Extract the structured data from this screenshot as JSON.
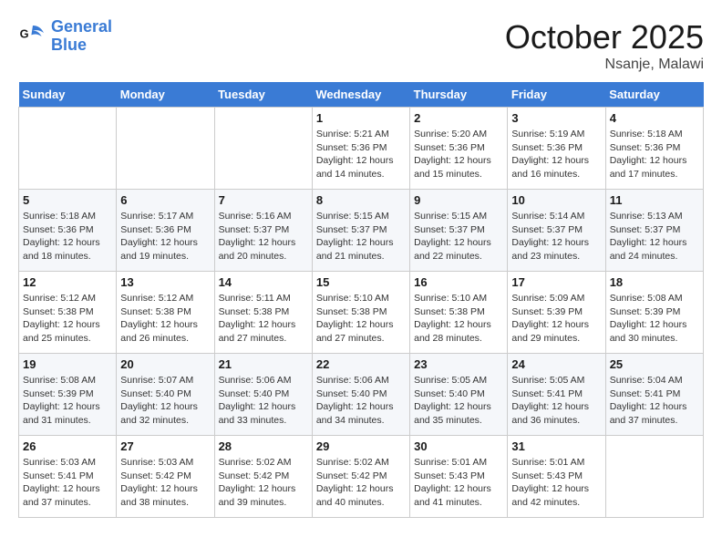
{
  "logo": {
    "line1": "General",
    "line2": "Blue"
  },
  "title": "October 2025",
  "location": "Nsanje, Malawi",
  "days_of_week": [
    "Sunday",
    "Monday",
    "Tuesday",
    "Wednesday",
    "Thursday",
    "Friday",
    "Saturday"
  ],
  "weeks": [
    [
      {
        "day": "",
        "sunrise": "",
        "sunset": "",
        "daylight": ""
      },
      {
        "day": "",
        "sunrise": "",
        "sunset": "",
        "daylight": ""
      },
      {
        "day": "",
        "sunrise": "",
        "sunset": "",
        "daylight": ""
      },
      {
        "day": "1",
        "sunrise": "Sunrise: 5:21 AM",
        "sunset": "Sunset: 5:36 PM",
        "daylight": "Daylight: 12 hours and 14 minutes."
      },
      {
        "day": "2",
        "sunrise": "Sunrise: 5:20 AM",
        "sunset": "Sunset: 5:36 PM",
        "daylight": "Daylight: 12 hours and 15 minutes."
      },
      {
        "day": "3",
        "sunrise": "Sunrise: 5:19 AM",
        "sunset": "Sunset: 5:36 PM",
        "daylight": "Daylight: 12 hours and 16 minutes."
      },
      {
        "day": "4",
        "sunrise": "Sunrise: 5:18 AM",
        "sunset": "Sunset: 5:36 PM",
        "daylight": "Daylight: 12 hours and 17 minutes."
      }
    ],
    [
      {
        "day": "5",
        "sunrise": "Sunrise: 5:18 AM",
        "sunset": "Sunset: 5:36 PM",
        "daylight": "Daylight: 12 hours and 18 minutes."
      },
      {
        "day": "6",
        "sunrise": "Sunrise: 5:17 AM",
        "sunset": "Sunset: 5:36 PM",
        "daylight": "Daylight: 12 hours and 19 minutes."
      },
      {
        "day": "7",
        "sunrise": "Sunrise: 5:16 AM",
        "sunset": "Sunset: 5:37 PM",
        "daylight": "Daylight: 12 hours and 20 minutes."
      },
      {
        "day": "8",
        "sunrise": "Sunrise: 5:15 AM",
        "sunset": "Sunset: 5:37 PM",
        "daylight": "Daylight: 12 hours and 21 minutes."
      },
      {
        "day": "9",
        "sunrise": "Sunrise: 5:15 AM",
        "sunset": "Sunset: 5:37 PM",
        "daylight": "Daylight: 12 hours and 22 minutes."
      },
      {
        "day": "10",
        "sunrise": "Sunrise: 5:14 AM",
        "sunset": "Sunset: 5:37 PM",
        "daylight": "Daylight: 12 hours and 23 minutes."
      },
      {
        "day": "11",
        "sunrise": "Sunrise: 5:13 AM",
        "sunset": "Sunset: 5:37 PM",
        "daylight": "Daylight: 12 hours and 24 minutes."
      }
    ],
    [
      {
        "day": "12",
        "sunrise": "Sunrise: 5:12 AM",
        "sunset": "Sunset: 5:38 PM",
        "daylight": "Daylight: 12 hours and 25 minutes."
      },
      {
        "day": "13",
        "sunrise": "Sunrise: 5:12 AM",
        "sunset": "Sunset: 5:38 PM",
        "daylight": "Daylight: 12 hours and 26 minutes."
      },
      {
        "day": "14",
        "sunrise": "Sunrise: 5:11 AM",
        "sunset": "Sunset: 5:38 PM",
        "daylight": "Daylight: 12 hours and 27 minutes."
      },
      {
        "day": "15",
        "sunrise": "Sunrise: 5:10 AM",
        "sunset": "Sunset: 5:38 PM",
        "daylight": "Daylight: 12 hours and 27 minutes."
      },
      {
        "day": "16",
        "sunrise": "Sunrise: 5:10 AM",
        "sunset": "Sunset: 5:38 PM",
        "daylight": "Daylight: 12 hours and 28 minutes."
      },
      {
        "day": "17",
        "sunrise": "Sunrise: 5:09 AM",
        "sunset": "Sunset: 5:39 PM",
        "daylight": "Daylight: 12 hours and 29 minutes."
      },
      {
        "day": "18",
        "sunrise": "Sunrise: 5:08 AM",
        "sunset": "Sunset: 5:39 PM",
        "daylight": "Daylight: 12 hours and 30 minutes."
      }
    ],
    [
      {
        "day": "19",
        "sunrise": "Sunrise: 5:08 AM",
        "sunset": "Sunset: 5:39 PM",
        "daylight": "Daylight: 12 hours and 31 minutes."
      },
      {
        "day": "20",
        "sunrise": "Sunrise: 5:07 AM",
        "sunset": "Sunset: 5:40 PM",
        "daylight": "Daylight: 12 hours and 32 minutes."
      },
      {
        "day": "21",
        "sunrise": "Sunrise: 5:06 AM",
        "sunset": "Sunset: 5:40 PM",
        "daylight": "Daylight: 12 hours and 33 minutes."
      },
      {
        "day": "22",
        "sunrise": "Sunrise: 5:06 AM",
        "sunset": "Sunset: 5:40 PM",
        "daylight": "Daylight: 12 hours and 34 minutes."
      },
      {
        "day": "23",
        "sunrise": "Sunrise: 5:05 AM",
        "sunset": "Sunset: 5:40 PM",
        "daylight": "Daylight: 12 hours and 35 minutes."
      },
      {
        "day": "24",
        "sunrise": "Sunrise: 5:05 AM",
        "sunset": "Sunset: 5:41 PM",
        "daylight": "Daylight: 12 hours and 36 minutes."
      },
      {
        "day": "25",
        "sunrise": "Sunrise: 5:04 AM",
        "sunset": "Sunset: 5:41 PM",
        "daylight": "Daylight: 12 hours and 37 minutes."
      }
    ],
    [
      {
        "day": "26",
        "sunrise": "Sunrise: 5:03 AM",
        "sunset": "Sunset: 5:41 PM",
        "daylight": "Daylight: 12 hours and 37 minutes."
      },
      {
        "day": "27",
        "sunrise": "Sunrise: 5:03 AM",
        "sunset": "Sunset: 5:42 PM",
        "daylight": "Daylight: 12 hours and 38 minutes."
      },
      {
        "day": "28",
        "sunrise": "Sunrise: 5:02 AM",
        "sunset": "Sunset: 5:42 PM",
        "daylight": "Daylight: 12 hours and 39 minutes."
      },
      {
        "day": "29",
        "sunrise": "Sunrise: 5:02 AM",
        "sunset": "Sunset: 5:42 PM",
        "daylight": "Daylight: 12 hours and 40 minutes."
      },
      {
        "day": "30",
        "sunrise": "Sunrise: 5:01 AM",
        "sunset": "Sunset: 5:43 PM",
        "daylight": "Daylight: 12 hours and 41 minutes."
      },
      {
        "day": "31",
        "sunrise": "Sunrise: 5:01 AM",
        "sunset": "Sunset: 5:43 PM",
        "daylight": "Daylight: 12 hours and 42 minutes."
      },
      {
        "day": "",
        "sunrise": "",
        "sunset": "",
        "daylight": ""
      }
    ]
  ]
}
